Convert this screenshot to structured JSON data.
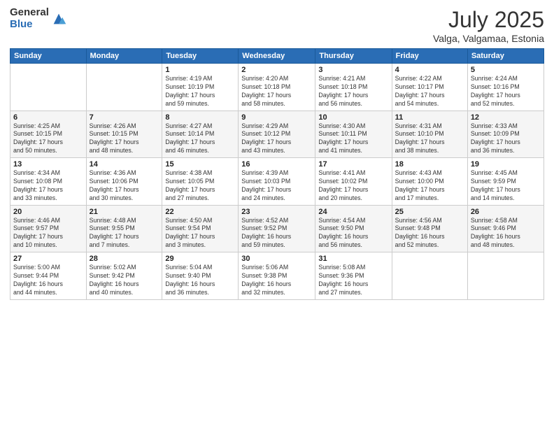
{
  "logo": {
    "general": "General",
    "blue": "Blue"
  },
  "title": "July 2025",
  "subtitle": "Valga, Valgamaa, Estonia",
  "days_header": [
    "Sunday",
    "Monday",
    "Tuesday",
    "Wednesday",
    "Thursday",
    "Friday",
    "Saturday"
  ],
  "weeks": [
    [
      {
        "day": "",
        "info": ""
      },
      {
        "day": "",
        "info": ""
      },
      {
        "day": "1",
        "info": "Sunrise: 4:19 AM\nSunset: 10:19 PM\nDaylight: 17 hours\nand 59 minutes."
      },
      {
        "day": "2",
        "info": "Sunrise: 4:20 AM\nSunset: 10:18 PM\nDaylight: 17 hours\nand 58 minutes."
      },
      {
        "day": "3",
        "info": "Sunrise: 4:21 AM\nSunset: 10:18 PM\nDaylight: 17 hours\nand 56 minutes."
      },
      {
        "day": "4",
        "info": "Sunrise: 4:22 AM\nSunset: 10:17 PM\nDaylight: 17 hours\nand 54 minutes."
      },
      {
        "day": "5",
        "info": "Sunrise: 4:24 AM\nSunset: 10:16 PM\nDaylight: 17 hours\nand 52 minutes."
      }
    ],
    [
      {
        "day": "6",
        "info": "Sunrise: 4:25 AM\nSunset: 10:15 PM\nDaylight: 17 hours\nand 50 minutes."
      },
      {
        "day": "7",
        "info": "Sunrise: 4:26 AM\nSunset: 10:15 PM\nDaylight: 17 hours\nand 48 minutes."
      },
      {
        "day": "8",
        "info": "Sunrise: 4:27 AM\nSunset: 10:14 PM\nDaylight: 17 hours\nand 46 minutes."
      },
      {
        "day": "9",
        "info": "Sunrise: 4:29 AM\nSunset: 10:12 PM\nDaylight: 17 hours\nand 43 minutes."
      },
      {
        "day": "10",
        "info": "Sunrise: 4:30 AM\nSunset: 10:11 PM\nDaylight: 17 hours\nand 41 minutes."
      },
      {
        "day": "11",
        "info": "Sunrise: 4:31 AM\nSunset: 10:10 PM\nDaylight: 17 hours\nand 38 minutes."
      },
      {
        "day": "12",
        "info": "Sunrise: 4:33 AM\nSunset: 10:09 PM\nDaylight: 17 hours\nand 36 minutes."
      }
    ],
    [
      {
        "day": "13",
        "info": "Sunrise: 4:34 AM\nSunset: 10:08 PM\nDaylight: 17 hours\nand 33 minutes."
      },
      {
        "day": "14",
        "info": "Sunrise: 4:36 AM\nSunset: 10:06 PM\nDaylight: 17 hours\nand 30 minutes."
      },
      {
        "day": "15",
        "info": "Sunrise: 4:38 AM\nSunset: 10:05 PM\nDaylight: 17 hours\nand 27 minutes."
      },
      {
        "day": "16",
        "info": "Sunrise: 4:39 AM\nSunset: 10:03 PM\nDaylight: 17 hours\nand 24 minutes."
      },
      {
        "day": "17",
        "info": "Sunrise: 4:41 AM\nSunset: 10:02 PM\nDaylight: 17 hours\nand 20 minutes."
      },
      {
        "day": "18",
        "info": "Sunrise: 4:43 AM\nSunset: 10:00 PM\nDaylight: 17 hours\nand 17 minutes."
      },
      {
        "day": "19",
        "info": "Sunrise: 4:45 AM\nSunset: 9:59 PM\nDaylight: 17 hours\nand 14 minutes."
      }
    ],
    [
      {
        "day": "20",
        "info": "Sunrise: 4:46 AM\nSunset: 9:57 PM\nDaylight: 17 hours\nand 10 minutes."
      },
      {
        "day": "21",
        "info": "Sunrise: 4:48 AM\nSunset: 9:55 PM\nDaylight: 17 hours\nand 7 minutes."
      },
      {
        "day": "22",
        "info": "Sunrise: 4:50 AM\nSunset: 9:54 PM\nDaylight: 17 hours\nand 3 minutes."
      },
      {
        "day": "23",
        "info": "Sunrise: 4:52 AM\nSunset: 9:52 PM\nDaylight: 16 hours\nand 59 minutes."
      },
      {
        "day": "24",
        "info": "Sunrise: 4:54 AM\nSunset: 9:50 PM\nDaylight: 16 hours\nand 56 minutes."
      },
      {
        "day": "25",
        "info": "Sunrise: 4:56 AM\nSunset: 9:48 PM\nDaylight: 16 hours\nand 52 minutes."
      },
      {
        "day": "26",
        "info": "Sunrise: 4:58 AM\nSunset: 9:46 PM\nDaylight: 16 hours\nand 48 minutes."
      }
    ],
    [
      {
        "day": "27",
        "info": "Sunrise: 5:00 AM\nSunset: 9:44 PM\nDaylight: 16 hours\nand 44 minutes."
      },
      {
        "day": "28",
        "info": "Sunrise: 5:02 AM\nSunset: 9:42 PM\nDaylight: 16 hours\nand 40 minutes."
      },
      {
        "day": "29",
        "info": "Sunrise: 5:04 AM\nSunset: 9:40 PM\nDaylight: 16 hours\nand 36 minutes."
      },
      {
        "day": "30",
        "info": "Sunrise: 5:06 AM\nSunset: 9:38 PM\nDaylight: 16 hours\nand 32 minutes."
      },
      {
        "day": "31",
        "info": "Sunrise: 5:08 AM\nSunset: 9:36 PM\nDaylight: 16 hours\nand 27 minutes."
      },
      {
        "day": "",
        "info": ""
      },
      {
        "day": "",
        "info": ""
      }
    ]
  ]
}
